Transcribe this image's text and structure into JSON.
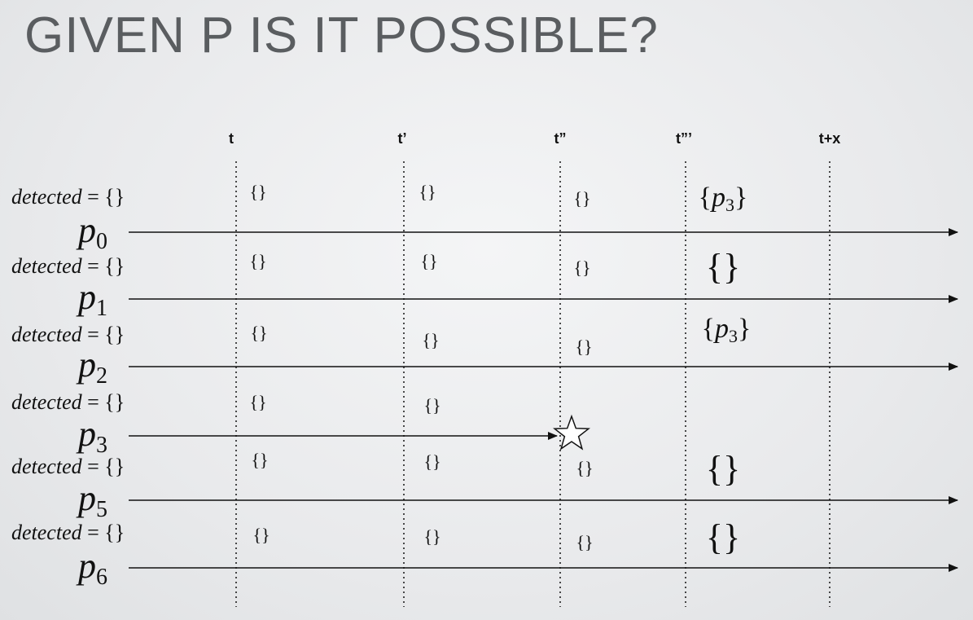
{
  "title": "GIVEN P IS IT POSSIBLE?",
  "time_labels": [
    "t",
    "t’",
    "t”",
    "t”’",
    "t+x"
  ],
  "detected_label": {
    "var": "detected",
    "rest": " = {}"
  },
  "processes": [
    {
      "name": "p",
      "sub": "0",
      "sets": [
        "{}",
        "{}",
        "{}",
        "{p3}"
      ]
    },
    {
      "name": "p",
      "sub": "1",
      "sets": [
        "{}",
        "{}",
        "{}",
        "{}"
      ]
    },
    {
      "name": "p",
      "sub": "2",
      "sets": [
        "{}",
        "{}",
        "{}",
        "{p3}"
      ]
    },
    {
      "name": "p",
      "sub": "3",
      "sets": [
        "{}",
        "{}"
      ],
      "crashed": true
    },
    {
      "name": "p",
      "sub": "5",
      "sets": [
        "{}",
        "{}",
        "{}",
        "{}"
      ]
    },
    {
      "name": "p",
      "sub": "6",
      "sets": [
        "{}",
        "{}",
        "{}",
        "{}"
      ]
    }
  ],
  "crash_marker": "star-icon"
}
